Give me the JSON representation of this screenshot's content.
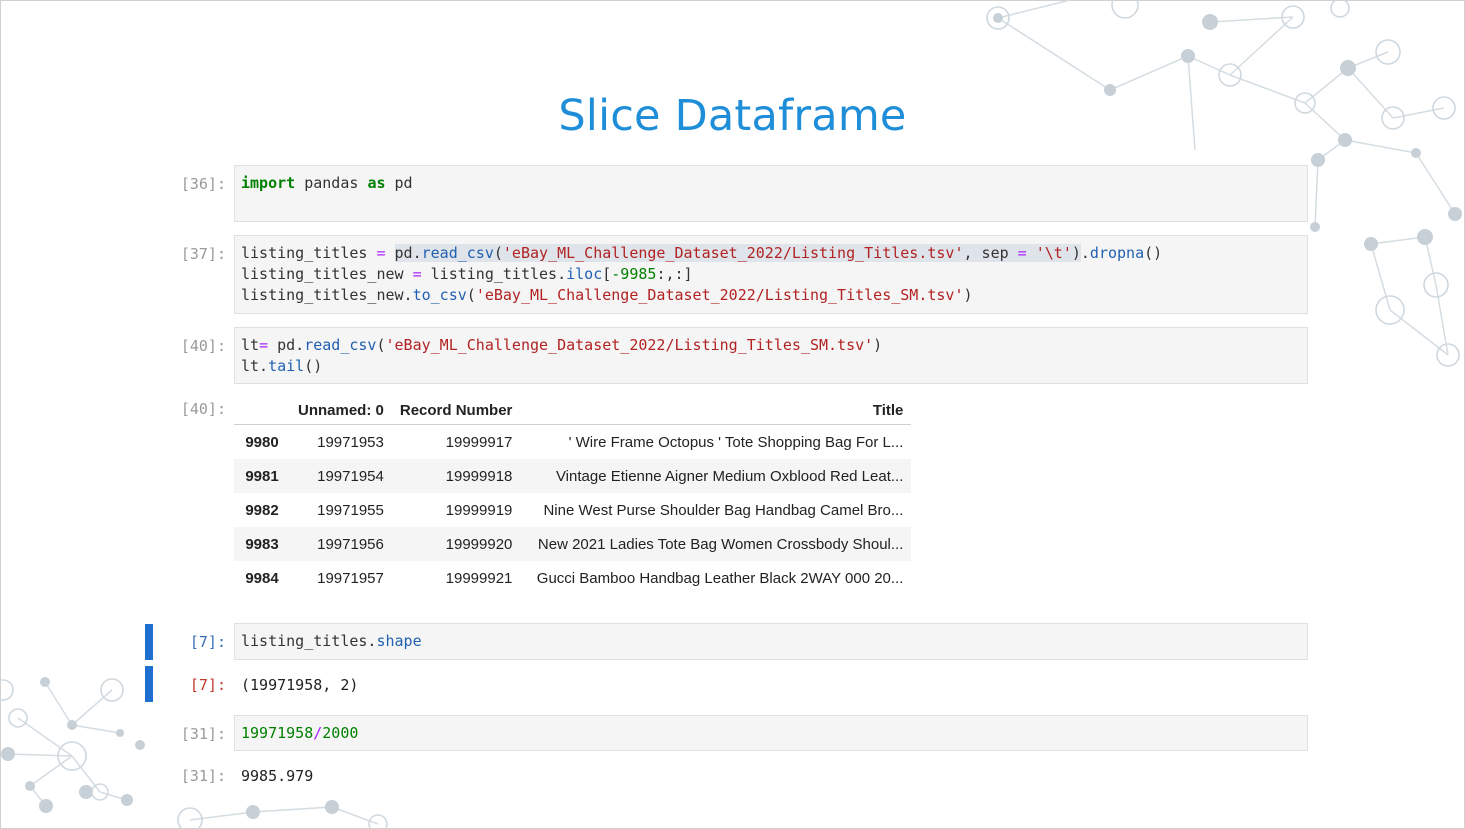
{
  "slide": {
    "title": "Slice Dataframe"
  },
  "cells": {
    "c36": {
      "in_prompt": "[36]:"
    },
    "c37": {
      "in_prompt": "[37]:"
    },
    "c40": {
      "in_prompt": "[40]:",
      "out_prompt": "[40]:"
    },
    "c7": {
      "in_prompt": "[7]:",
      "out_prompt": "[7]:",
      "output": "(19971958, 2)"
    },
    "c31": {
      "in_prompt": "[31]:",
      "out_prompt": "[31]:",
      "output": "9985.979"
    }
  },
  "dataframe": {
    "columns": [
      "",
      "Unnamed: 0",
      "Record Number",
      "Title"
    ],
    "rows": [
      [
        "9980",
        "19971953",
        "19999917",
        "' Wire Frame Octopus ' Tote Shopping Bag For L..."
      ],
      [
        "9981",
        "19971954",
        "19999918",
        "Vintage Etienne Aigner Medium Oxblood Red Leat..."
      ],
      [
        "9982",
        "19971955",
        "19999919",
        "Nine West Purse Shoulder Bag Handbag Camel Bro..."
      ],
      [
        "9983",
        "19971956",
        "19999920",
        "New 2021 Ladies Tote Bag Women Crossbody Shoul..."
      ],
      [
        "9984",
        "19971957",
        "19999921",
        "Gucci Bamboo Handbag Leather Black 2WAY 000 20..."
      ]
    ]
  },
  "code_tokens": {
    "import": "import",
    "pandas": " pandas ",
    "as": "as",
    "pd": " pd",
    "l37a1": "listing_titles ",
    "eq": "=",
    "sp": " ",
    "pd_dot": "pd.",
    "read_csv": "read_csv",
    "paren_open": "(",
    "path_full": "'eBay_ML_Challenge_Dataset_2022/Listing_Titles.tsv'",
    "comma_sep": ", sep ",
    "tab_str": "'\\t'",
    "paren_close": ")",
    "dot": ".",
    "dropna": "dropna",
    "call": "()",
    "l37b1": "listing_titles_new ",
    "l37b2": " listing_titles.",
    "iloc": "iloc",
    "bracket_open": "[",
    "neg": "-9985",
    "slice_rest": ":,:]",
    "l37c1": "listing_titles_new.",
    "to_csv": "to_csv",
    "path_sm": "'eBay_ML_Challenge_Dataset_2022/Listing_Titles_SM.tsv'",
    "lt": "lt",
    "lt_sp": " pd.",
    "lt_dot": "lt.",
    "tail": "tail",
    "shape_obj": "listing_titles.",
    "shape": "shape",
    "n1": "19971958",
    "slash": "/",
    "n2": "2000"
  },
  "colors": {
    "title": "#1f8ed9",
    "keyword": "#008000",
    "string": "#b22222",
    "function": "#2160b0",
    "operator": "#aa22ff",
    "selection": "#1f6fce"
  }
}
